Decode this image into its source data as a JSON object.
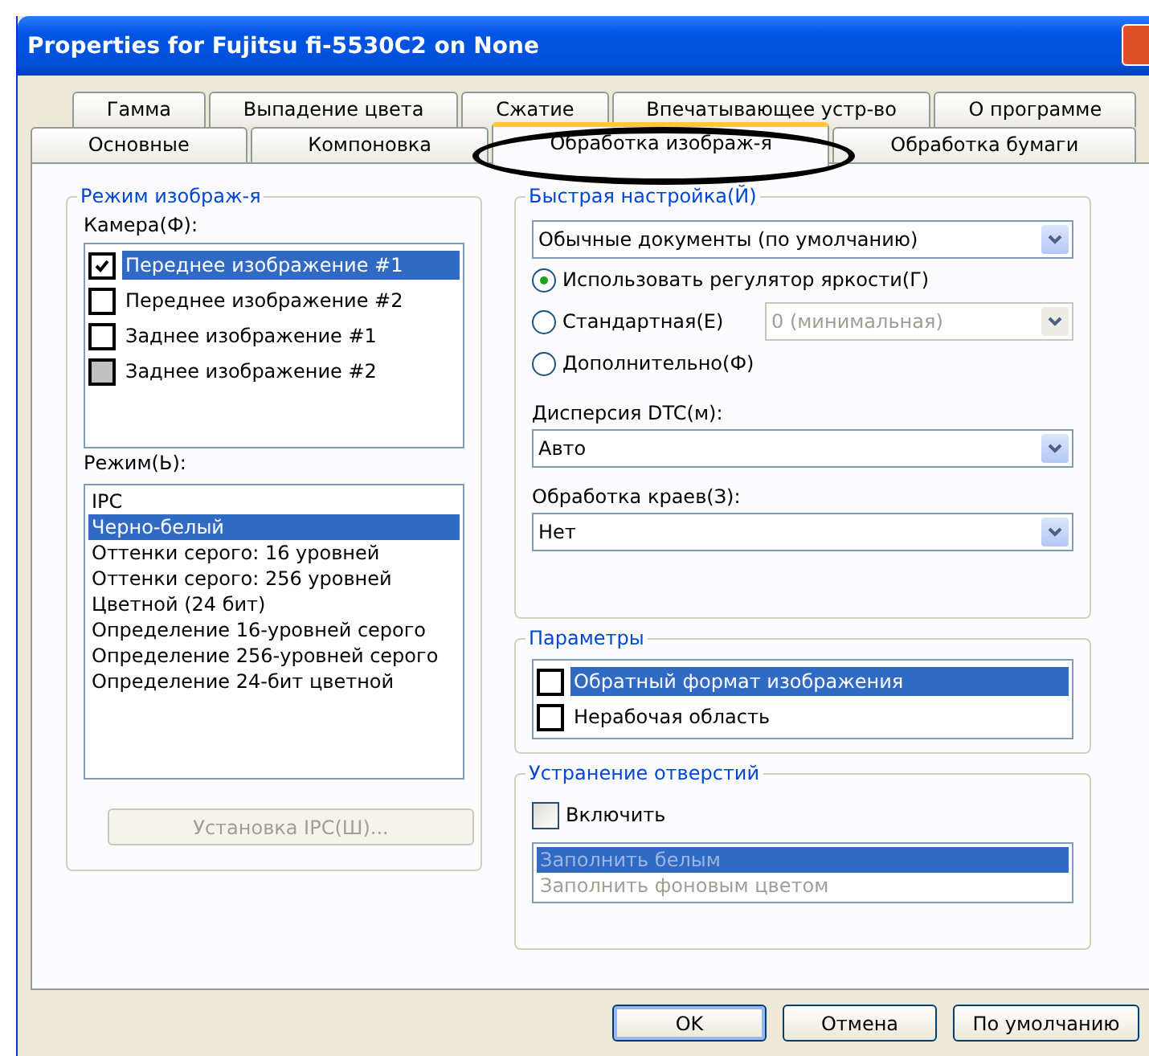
{
  "window": {
    "title": "Properties for Fujitsu fi-5530C2 on None"
  },
  "tab_rows": [
    [
      {
        "label": "Гамма",
        "selected": false
      },
      {
        "label": "Выпадение цвета",
        "selected": false
      },
      {
        "label": "Сжатие",
        "selected": false
      },
      {
        "label": "Впечатывающее устр-во",
        "selected": false
      },
      {
        "label": "О программе",
        "selected": false
      }
    ],
    [
      {
        "label": "Основные",
        "selected": false
      },
      {
        "label": "Компоновка",
        "selected": false
      },
      {
        "label": "Обработка изображ-я",
        "selected": true
      },
      {
        "label": "Обработка бумаги",
        "selected": false
      }
    ]
  ],
  "image_mode": {
    "title": "Режим изображ-я",
    "camera_label": "Камера(Ф):",
    "cameras": [
      {
        "label": "Переднее изображение #1",
        "checked": true,
        "disabled": false,
        "selected": true
      },
      {
        "label": "Переднее изображение #2",
        "checked": false,
        "disabled": false,
        "selected": false
      },
      {
        "label": "Заднее изображение #1",
        "checked": false,
        "disabled": false,
        "selected": false
      },
      {
        "label": "Заднее изображение #2",
        "checked": false,
        "disabled": true,
        "selected": false
      }
    ],
    "mode_label": "Режим(Ь):",
    "modes": [
      {
        "label": "IPC",
        "selected": false
      },
      {
        "label": "Черно-белый",
        "selected": true
      },
      {
        "label": "Оттенки серого: 16 уровней",
        "selected": false
      },
      {
        "label": "Оттенки серого: 256 уровней",
        "selected": false
      },
      {
        "label": "Цветной (24 бит)",
        "selected": false
      },
      {
        "label": "Определение 16-уровней серого",
        "selected": false
      },
      {
        "label": "Определение 256-уровней серого",
        "selected": false
      },
      {
        "label": "Определение 24-бит цветной",
        "selected": false
      }
    ],
    "ipc_button": {
      "label": "Установка IPC(Ш)...",
      "disabled": true
    }
  },
  "quick_setup": {
    "title": "Быстрая настройка(Й)",
    "preset": {
      "value": "Обычные документы (по умолчанию)",
      "disabled": false
    },
    "radios": [
      {
        "label": "Использовать регулятор яркости(Г)",
        "selected": true
      },
      {
        "label": "Стандартная(Е)",
        "selected": false
      },
      {
        "label": "Дополнительно(Ф)",
        "selected": false
      }
    ],
    "standard_level": {
      "value": "0 (минимальная)",
      "disabled": true
    },
    "dtc": {
      "label": "Дисперсия DTC(м):",
      "value": "Авто",
      "disabled": false
    },
    "edge": {
      "label": "Обработка краев(З):",
      "value": "Нет",
      "disabled": false
    }
  },
  "parameters": {
    "title": "Параметры",
    "items": [
      {
        "label": "Обратный формат изображения",
        "checked": false,
        "selected": true
      },
      {
        "label": "Нерабочая область",
        "checked": false,
        "selected": false
      }
    ]
  },
  "hole_removal": {
    "title": "Устранение  отверстий",
    "enable": {
      "label": "Включить",
      "checked": false
    },
    "disabled": true,
    "options": [
      {
        "label": "Заполнить белым",
        "selected": true
      },
      {
        "label": "Заполнить фоновым цветом",
        "selected": false
      }
    ]
  },
  "buttons": [
    {
      "label": "OK",
      "default": true
    },
    {
      "label": "Отмена",
      "default": false
    },
    {
      "label": "По умолчанию",
      "default": false
    }
  ]
}
